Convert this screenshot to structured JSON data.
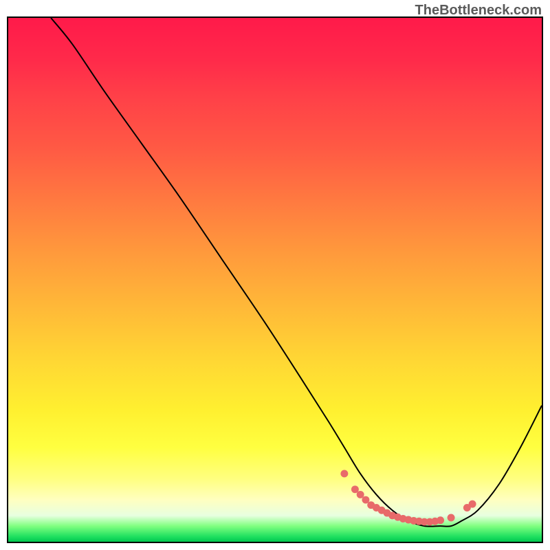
{
  "watermark": "TheBottleneck.com",
  "chart_data": {
    "type": "line",
    "title": "",
    "xlabel": "",
    "ylabel": "",
    "xlim": [
      0,
      100
    ],
    "ylim": [
      0,
      100
    ],
    "series": [
      {
        "name": "curve",
        "x": [
          8,
          12,
          18,
          25,
          32,
          40,
          48,
          55,
          60,
          63,
          66,
          69,
          72,
          75,
          78,
          81,
          83,
          85,
          88,
          92,
          96,
          100
        ],
        "y": [
          100,
          95,
          86,
          76,
          66,
          54,
          42,
          31,
          23,
          18,
          13,
          9,
          6,
          4,
          3,
          3,
          3,
          4,
          6,
          11,
          18,
          26
        ]
      }
    ],
    "markers": {
      "name": "dots",
      "x": [
        63,
        65,
        66,
        67,
        68,
        69,
        70,
        71,
        72,
        73,
        74,
        75,
        76,
        77,
        78,
        79,
        80,
        81,
        83,
        86,
        87
      ],
      "y": [
        13,
        10,
        9,
        8,
        7,
        6.5,
        6,
        5.5,
        5,
        4.7,
        4.4,
        4.2,
        4.0,
        3.9,
        3.8,
        3.8,
        3.9,
        4.1,
        4.6,
        6.5,
        7.2
      ]
    },
    "gradient_stops": [
      {
        "pos": 0,
        "color": "#ff1a4a"
      },
      {
        "pos": 8,
        "color": "#ff2a4a"
      },
      {
        "pos": 15,
        "color": "#ff4048"
      },
      {
        "pos": 25,
        "color": "#ff5a44"
      },
      {
        "pos": 35,
        "color": "#ff7a40"
      },
      {
        "pos": 45,
        "color": "#ff9a3c"
      },
      {
        "pos": 55,
        "color": "#ffb838"
      },
      {
        "pos": 65,
        "color": "#ffd634"
      },
      {
        "pos": 75,
        "color": "#fff030"
      },
      {
        "pos": 82,
        "color": "#ffff40"
      },
      {
        "pos": 88,
        "color": "#ffff80"
      },
      {
        "pos": 92,
        "color": "#ffffc0"
      },
      {
        "pos": 95,
        "color": "#e8ffe0"
      },
      {
        "pos": 97,
        "color": "#80ff80"
      },
      {
        "pos": 99,
        "color": "#20e060"
      },
      {
        "pos": 100,
        "color": "#00c850"
      }
    ]
  }
}
